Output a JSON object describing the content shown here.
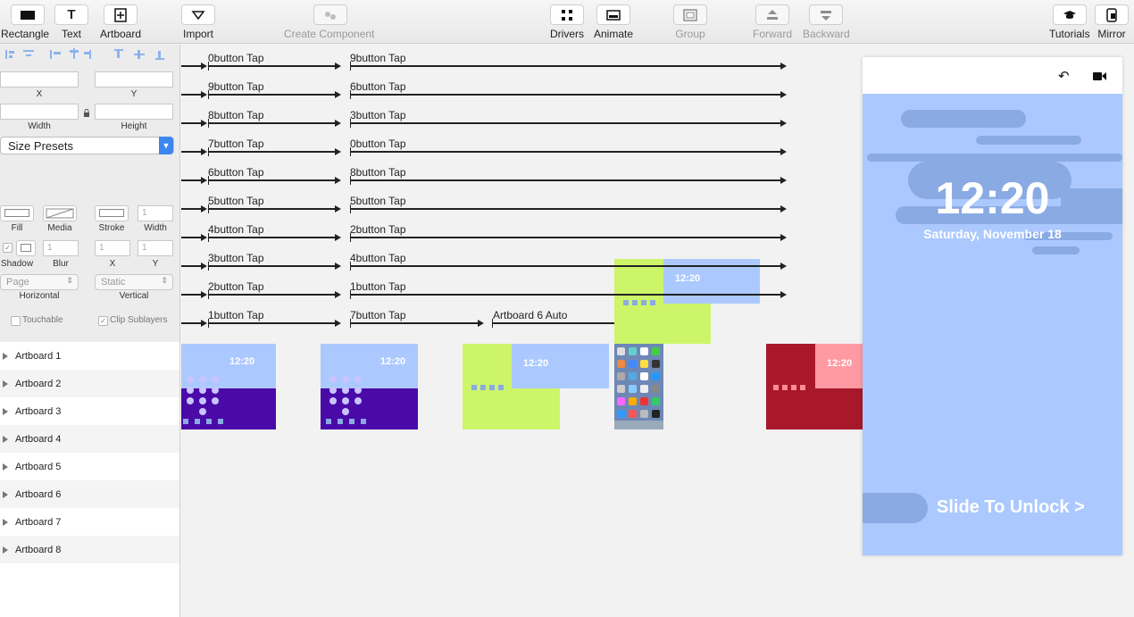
{
  "toolbar": {
    "rectangle": "Rectangle",
    "text": "Text",
    "artboard": "Artboard",
    "import": "Import",
    "create_component": "Create Component",
    "drivers": "Drivers",
    "animate": "Animate",
    "group": "Group",
    "forward": "Forward",
    "backward": "Backward",
    "tutorials": "Tutorials",
    "mirror": "Mirror"
  },
  "props": {
    "x": "X",
    "y": "Y",
    "width": "Width",
    "height": "Height",
    "size_presets": "Size Presets",
    "fill": "Fill",
    "media": "Media",
    "stroke": "Stroke",
    "stroke_width_label": "Width",
    "stroke_width_value": "1",
    "shadow": "Shadow",
    "blur": "Blur",
    "blur_value": "1",
    "shadow_x": "X",
    "shadow_x_value": "1",
    "shadow_y": "Y",
    "shadow_y_value": "1",
    "horizontal_value": "Page",
    "horizontal": "Horizontal",
    "vertical_value": "Static",
    "vertical": "Vertical",
    "touchable": "Touchable",
    "clip_sublayers": "Clip Sublayers"
  },
  "layers": [
    "Artboard 1",
    "Artboard 2",
    "Artboard 3",
    "Artboard 4",
    "Artboard 5",
    "Artboard 6",
    "Artboard 7",
    "Artboard 8"
  ],
  "canvas": {
    "col1": [
      "0button Tap",
      "9button Tap",
      "8button Tap",
      "7button Tap",
      "6button Tap",
      "5button Tap",
      "4button Tap",
      "3button Tap",
      "2button Tap",
      "1button Tap"
    ],
    "col2": [
      "9button Tap",
      "6button Tap",
      "3button Tap",
      "0button Tap",
      "8button Tap",
      "5button Tap",
      "2button Tap",
      "4button Tap",
      "1button Tap",
      "7button Tap"
    ],
    "auto_label": "Artboard 6 Auto"
  },
  "phone": {
    "time": "12:20",
    "date": "Saturday, November 18",
    "slide": "Slide To Unlock >"
  },
  "colors": {
    "accent": "#3d86f0",
    "lock_bg": "#abc9ff",
    "pill": "#8aaae3",
    "purple": "#4a0aa8",
    "lime": "#cdf56a",
    "red": "#a8182a"
  }
}
